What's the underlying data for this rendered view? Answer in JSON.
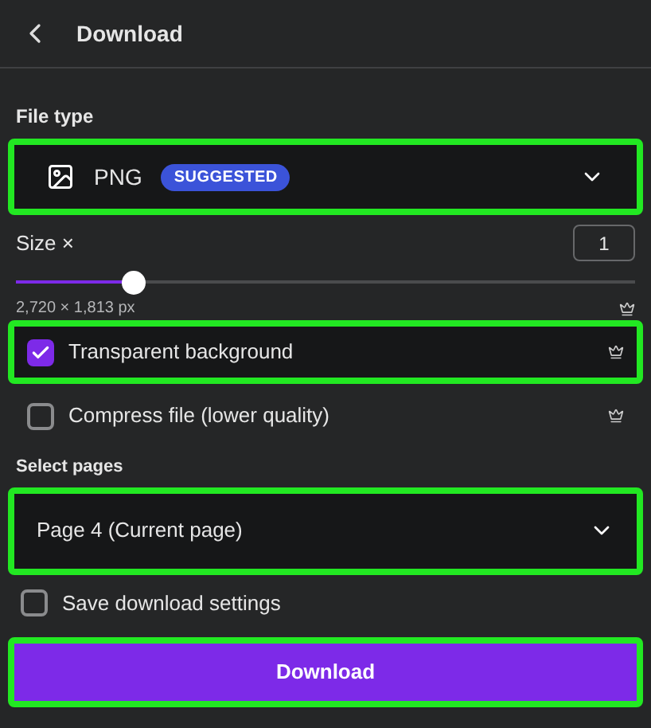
{
  "header": {
    "title": "Download"
  },
  "file_type": {
    "label": "File type",
    "value": "PNG",
    "badge": "SUGGESTED",
    "highlighted": true
  },
  "size": {
    "label": "Size ×",
    "value": "1",
    "level": 0.19,
    "dimensions": "2,720 × 1,813 px"
  },
  "options": [
    {
      "label": "Transparent background",
      "checked": true,
      "premium": true,
      "highlighted": true
    },
    {
      "label": "Compress file (lower quality)",
      "checked": false,
      "premium": true,
      "highlighted": false
    }
  ],
  "pages": {
    "label": "Select pages",
    "value": "Page 4 (Current page)",
    "highlighted": true
  },
  "save_settings": {
    "label": "Save download settings",
    "checked": false
  },
  "download_button": {
    "label": "Download",
    "highlighted": true
  }
}
